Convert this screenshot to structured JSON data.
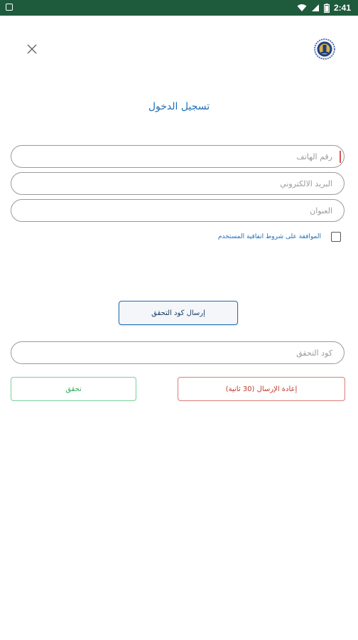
{
  "status_bar": {
    "time": "2:41"
  },
  "header": {
    "title": "تسجيل الدخول"
  },
  "form": {
    "phone_placeholder": "رقم الهاتف",
    "email_placeholder": "البريد الالكتروني",
    "address_placeholder": "العنوان",
    "terms_label": "الموافقة على شروط اتفاقية المستخدم",
    "send_code_label": "إرسال كود التحقق",
    "code_placeholder": "كود التحقق",
    "verify_label": "تحقق",
    "resend_label": "إعادة الإرسال (30 ثانية)"
  },
  "colors": {
    "status_bar": "#1e5a3c",
    "accent_blue": "#1f6fb7",
    "success_green": "#2eaa5a",
    "danger_red": "#c0392b"
  },
  "icons": {
    "close": "close-icon",
    "logo": "app-logo",
    "wifi": "wifi-icon",
    "signal": "signal-icon",
    "battery": "battery-icon"
  }
}
